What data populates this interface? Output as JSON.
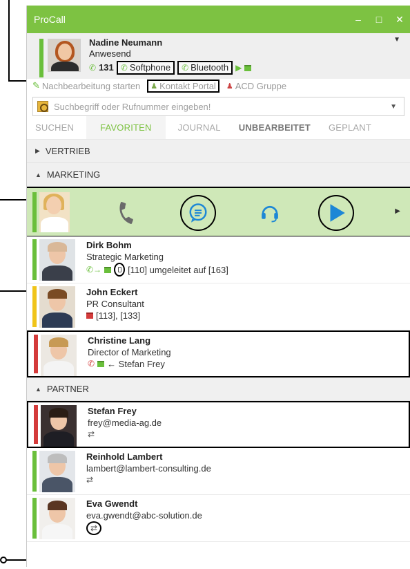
{
  "window": {
    "title": "ProCall",
    "minimize_icon": "minimize-icon",
    "maximize_icon": "maximize-icon",
    "close_icon": "close-icon"
  },
  "profile": {
    "name": "Nadine Neumann",
    "status": "Anwesend",
    "extension": "131",
    "device1": "Softphone",
    "device2": "Bluetooth",
    "status_color": "#6abf3b"
  },
  "actions": {
    "postprocessing": "Nachbearbeitung starten",
    "contact_portal": "Kontakt Portal",
    "acd_group": "ACD Gruppe"
  },
  "search": {
    "placeholder": "Suchbegriff oder Rufnummer eingeben!"
  },
  "tabs": [
    {
      "label": "SUCHEN"
    },
    {
      "label": "FAVORITEN"
    },
    {
      "label": "JOURNAL"
    },
    {
      "label": "UNBEARBEITET"
    },
    {
      "label": "GEPLANT"
    }
  ],
  "groups": {
    "vertrieb": "VERTRIEB",
    "marketing": "MARKETING",
    "partner": "PARTNER"
  },
  "marketing_contacts": [
    {
      "name": "Dirk Bohm",
      "sub": "Strategic Marketing",
      "line3": "[110] umgeleitet auf [163]",
      "status_color": "#6abf3b"
    },
    {
      "name": "John Eckert",
      "sub": "PR Consultant",
      "line3": "[113], [133]",
      "status_color": "#f0c419"
    },
    {
      "name": "Christine Lang",
      "sub": "Director of Marketing",
      "line3": "← Stefan Frey",
      "status_color": "#d43b3b"
    }
  ],
  "partner_contacts": [
    {
      "name": "Stefan Frey",
      "sub": "frey@media-ag.de",
      "status_color": "#d43b3b"
    },
    {
      "name": "Reinhold Lambert",
      "sub": "lambert@lambert-consulting.de",
      "status_color": "#6abf3b"
    },
    {
      "name": "Eva Gwendt",
      "sub": "eva.gwendt@abc-solution.de",
      "status_color": "#6abf3b"
    }
  ],
  "colors": {
    "accent": "#7dc242",
    "available": "#6abf3b",
    "busy": "#d43b3b",
    "away": "#f0c419",
    "call_blue": "#1d87d6"
  }
}
